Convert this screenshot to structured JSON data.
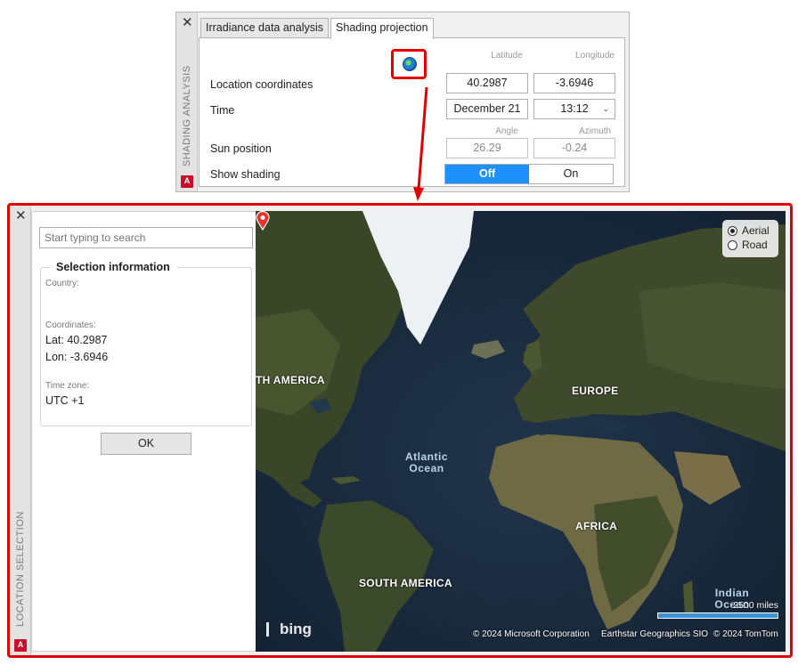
{
  "shading_palette": {
    "side_title": "SHADING ANALYSIS",
    "tabs": [
      {
        "label": "Irradiance data analysis",
        "active": false
      },
      {
        "label": "Shading projection",
        "active": true
      }
    ],
    "rows": {
      "location_label": "Location coordinates",
      "time_label": "Time",
      "sun_label": "Sun position",
      "shading_label": "Show shading"
    },
    "headers": {
      "latitude": "Latitude",
      "longitude": "Longitude",
      "angle": "Angle",
      "azimuth": "Azimuth"
    },
    "values": {
      "latitude": "40.2987",
      "longitude": "-3.6946",
      "date": "December 21",
      "time": "13:12",
      "angle": "26.29",
      "azimuth": "-0.24"
    },
    "toggle": {
      "off_label": "Off",
      "on_label": "On",
      "selected": "Off"
    },
    "badge": "A"
  },
  "location_palette": {
    "side_title": "LOCATION SELECTION",
    "search_placeholder": "Start typing to search",
    "selection_title": "Selection information",
    "country_label": "Country:",
    "coordinates_label": "Coordinates:",
    "lat_text": "Lat: 40.2987",
    "lon_text": "Lon: -3.6946",
    "timezone_label": "Time zone:",
    "timezone_value": "UTC +1",
    "ok_label": "OK",
    "badge": "A"
  },
  "map": {
    "modes": [
      {
        "label": "Aerial",
        "selected": true
      },
      {
        "label": "Road",
        "selected": false
      }
    ],
    "labels": {
      "north_america": "TH AMERICA",
      "europe": "EUROPE",
      "atlantic": "Atlantic Ocean",
      "africa": "AFRICA",
      "south_america": "SOUTH AMERICA",
      "indian": "Indian Ocean"
    },
    "brand": "bing",
    "copyright": [
      "© 2024 Microsoft Corporation",
      "Earthstar Geographics  SIO",
      "© 2024 TomTom"
    ],
    "scale": "2500 miles",
    "colors": {
      "land": "#3f4a2d",
      "ocean": "#1b2a3a",
      "ice": "#eef1f3",
      "pin": "#e8322b"
    }
  },
  "accent_colors": {
    "highlight": "#e00000",
    "toggle_on": "#1e90ff"
  }
}
